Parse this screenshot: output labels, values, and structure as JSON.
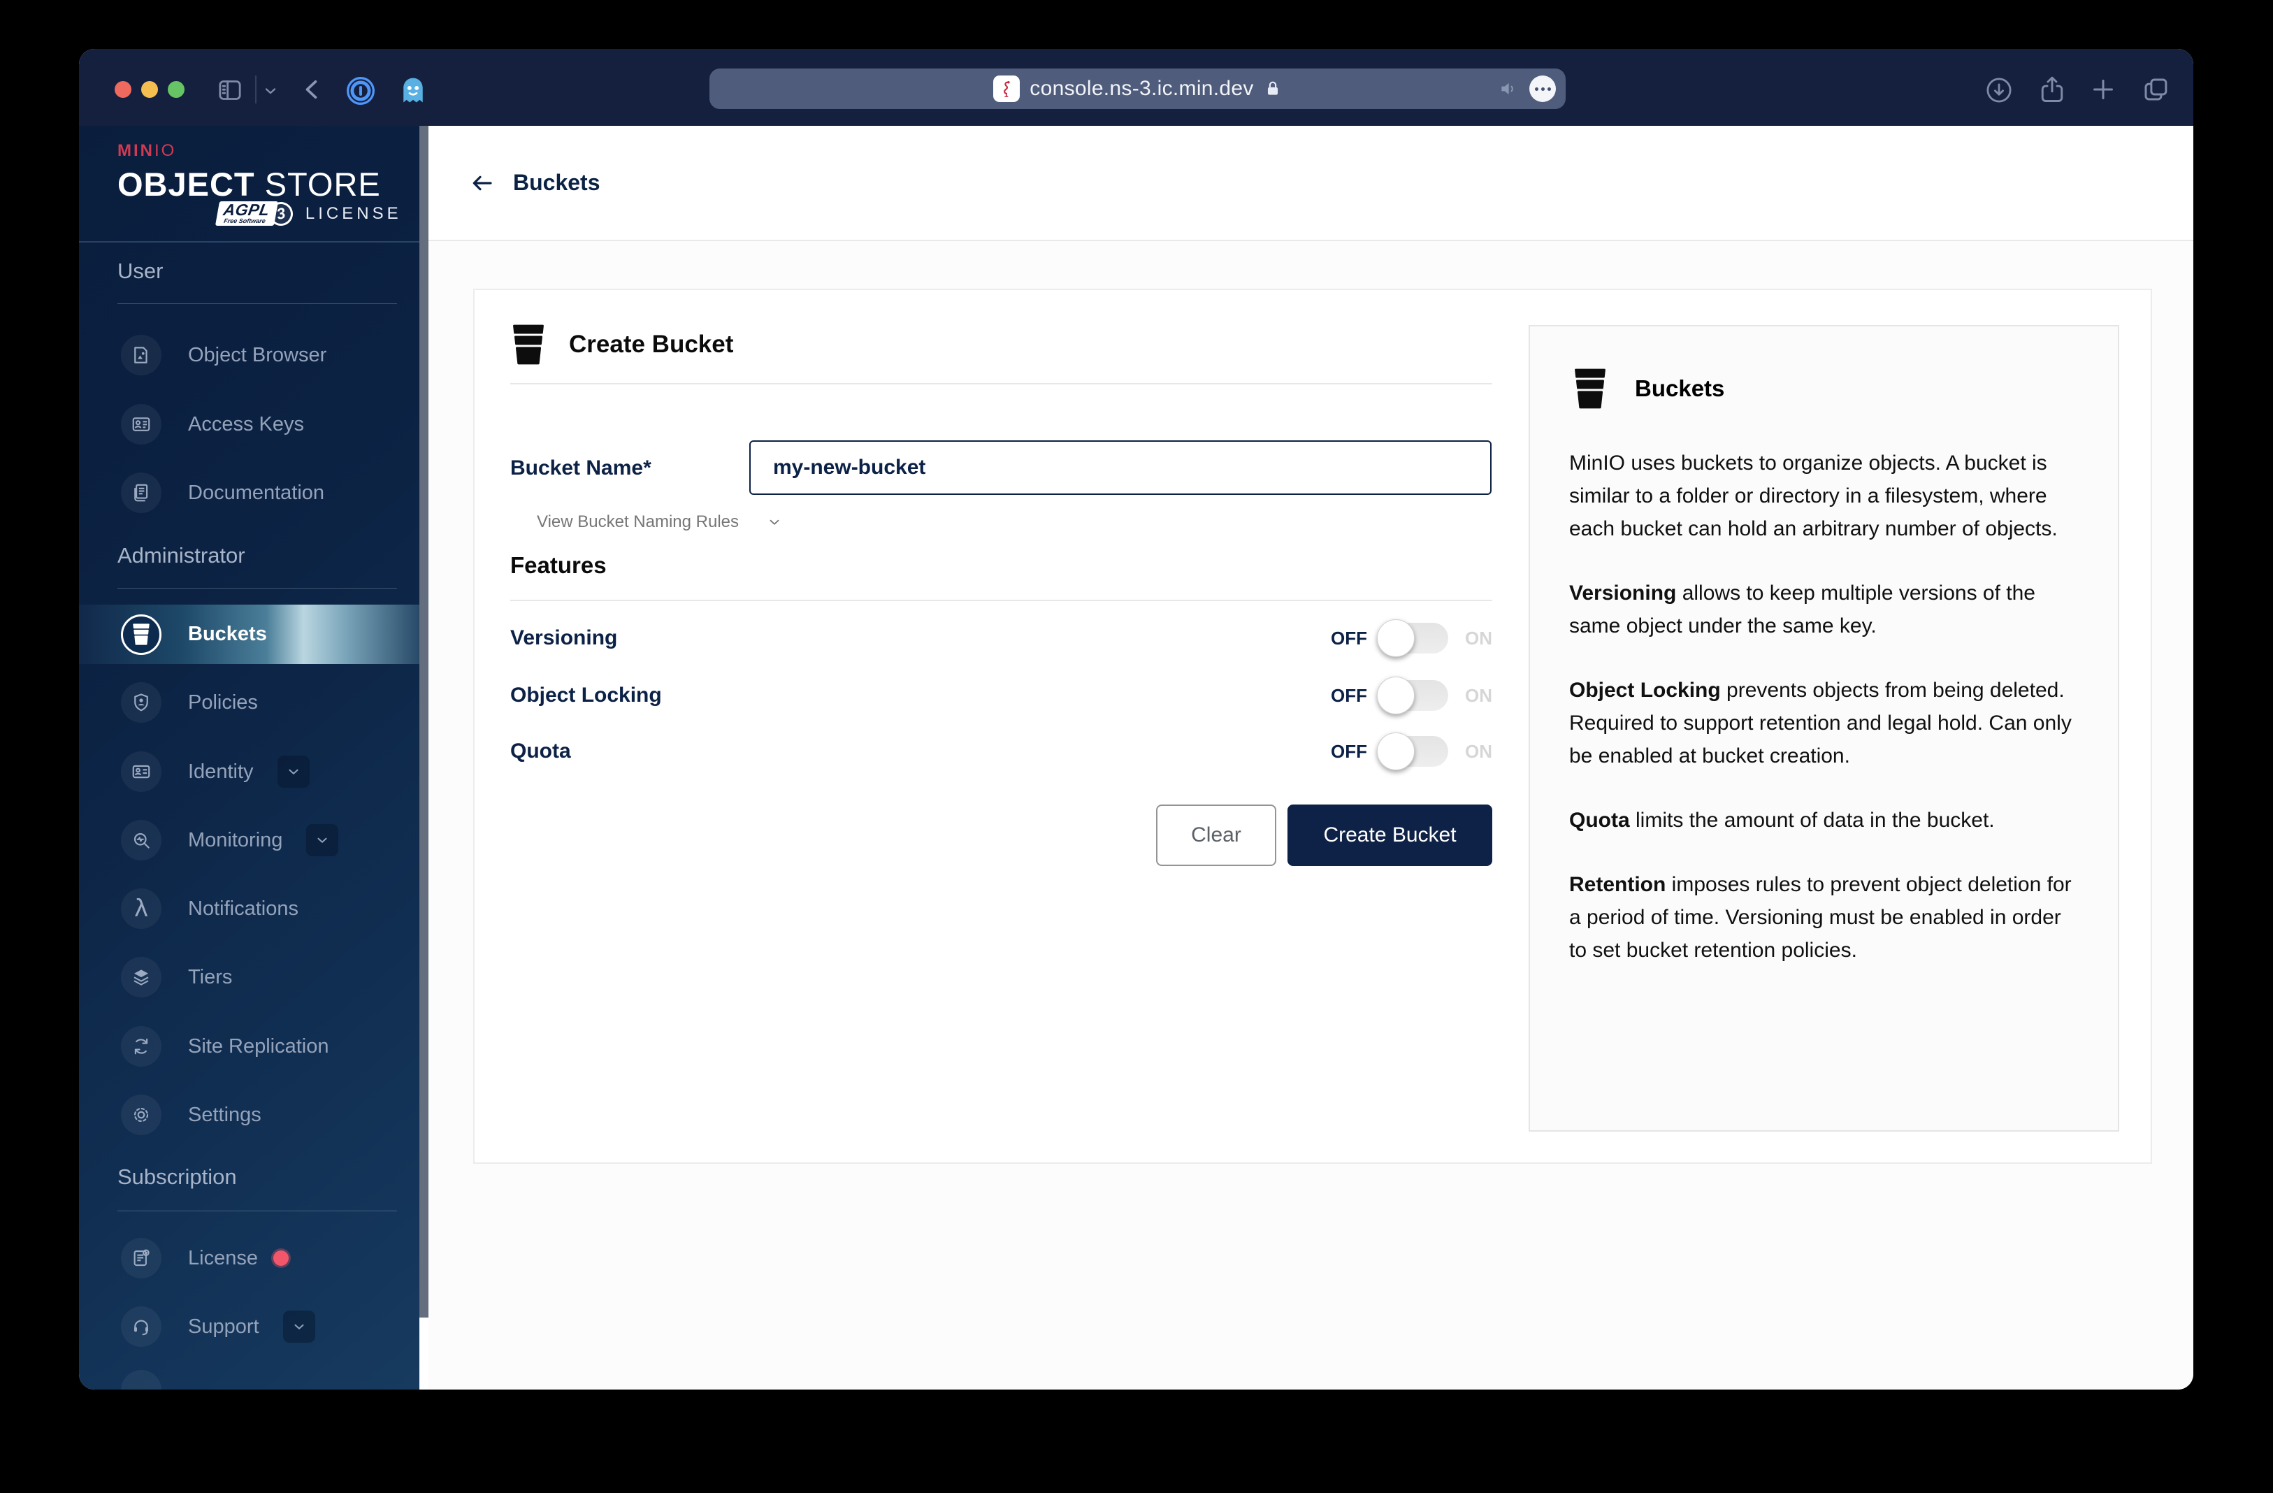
{
  "browser": {
    "url": "console.ns-3.ic.min.dev",
    "traffic_lights": {
      "close": "#ee6a5e",
      "minimize": "#f4be50",
      "zoom": "#66c464"
    }
  },
  "colors": {
    "brand_red": "#d13a52",
    "brand_navy": "#0c2146",
    "toolbar_bg": "#14203e",
    "license_alert": "#f2566a",
    "active_highlight": "#b9d6e0"
  },
  "sidebar": {
    "logo": {
      "brand_bold": "MIN",
      "brand_light": "IO",
      "title_bold": "OBJECT",
      "title_light": "STORE",
      "badge_main": "AGPL",
      "badge_sub": "Free Software",
      "badge_version": "3",
      "license_label": "LICENSE"
    },
    "sections": [
      {
        "label": "User",
        "items": [
          {
            "label": "Object Browser"
          },
          {
            "label": "Access Keys"
          },
          {
            "label": "Documentation"
          }
        ]
      },
      {
        "label": "Administrator",
        "items": [
          {
            "label": "Buckets"
          },
          {
            "label": "Policies"
          },
          {
            "label": "Identity"
          },
          {
            "label": "Monitoring"
          },
          {
            "label": "Notifications"
          },
          {
            "label": "Tiers"
          },
          {
            "label": "Site Replication"
          },
          {
            "label": "Settings"
          }
        ]
      },
      {
        "label": "Subscription",
        "items": [
          {
            "label": "License"
          },
          {
            "label": "Support"
          }
        ]
      }
    ]
  },
  "main": {
    "back_label": "Buckets",
    "form": {
      "title": "Create Bucket",
      "bucket_name_label": "Bucket Name*",
      "bucket_name_value": "my-new-bucket",
      "naming_rules_label": "View Bucket Naming Rules",
      "features_label": "Features",
      "toggles": [
        {
          "label": "Versioning",
          "off": "OFF",
          "on": "ON"
        },
        {
          "label": "Object Locking",
          "off": "OFF",
          "on": "ON"
        },
        {
          "label": "Quota",
          "off": "OFF",
          "on": "ON"
        }
      ],
      "clear_label": "Clear",
      "submit_label": "Create Bucket"
    },
    "info": {
      "title": "Buckets",
      "paragraphs": [
        {
          "bold": "",
          "text": "MinIO uses buckets to organize objects. A bucket is similar to a folder or directory in a filesystem, where each bucket can hold an arbitrary number of objects."
        },
        {
          "bold": "Versioning",
          "text": " allows to keep multiple versions of the same object under the same key."
        },
        {
          "bold": "Object Locking",
          "text": " prevents objects from being deleted. Required to support retention and legal hold. Can only be enabled at bucket creation."
        },
        {
          "bold": "Quota",
          "text": " limits the amount of data in the bucket."
        },
        {
          "bold": "Retention",
          "text": " imposes rules to prevent object deletion for a period of time. Versioning must be enabled in order to set bucket retention policies."
        }
      ]
    }
  }
}
